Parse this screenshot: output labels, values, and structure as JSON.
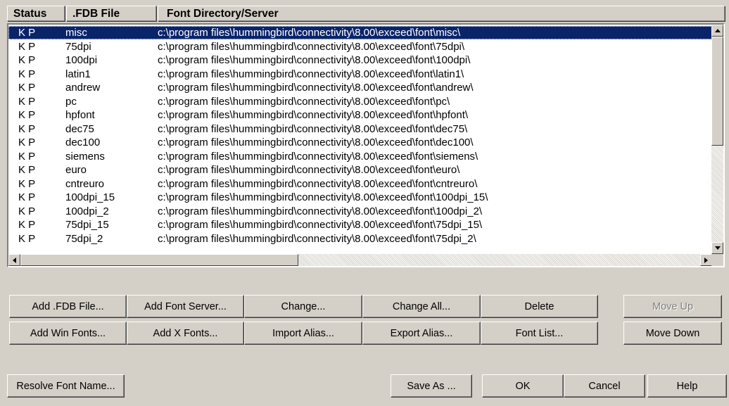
{
  "columns": {
    "status": "Status",
    "fdb": ".FDB File",
    "dir": "Font Directory/Server"
  },
  "rows": [
    {
      "status": "K P",
      "file": "misc",
      "dir": "c:\\program files\\hummingbird\\connectivity\\8.00\\exceed\\font\\misc\\"
    },
    {
      "status": "K P",
      "file": "75dpi",
      "dir": "c:\\program files\\hummingbird\\connectivity\\8.00\\exceed\\font\\75dpi\\"
    },
    {
      "status": "K P",
      "file": "100dpi",
      "dir": "c:\\program files\\hummingbird\\connectivity\\8.00\\exceed\\font\\100dpi\\"
    },
    {
      "status": "K P",
      "file": "latin1",
      "dir": "c:\\program files\\hummingbird\\connectivity\\8.00\\exceed\\font\\latin1\\"
    },
    {
      "status": "K P",
      "file": "andrew",
      "dir": "c:\\program files\\hummingbird\\connectivity\\8.00\\exceed\\font\\andrew\\"
    },
    {
      "status": "K P",
      "file": "pc",
      "dir": "c:\\program files\\hummingbird\\connectivity\\8.00\\exceed\\font\\pc\\"
    },
    {
      "status": "K P",
      "file": "hpfont",
      "dir": "c:\\program files\\hummingbird\\connectivity\\8.00\\exceed\\font\\hpfont\\"
    },
    {
      "status": "K P",
      "file": "dec75",
      "dir": "c:\\program files\\hummingbird\\connectivity\\8.00\\exceed\\font\\dec75\\"
    },
    {
      "status": "K P",
      "file": "dec100",
      "dir": "c:\\program files\\hummingbird\\connectivity\\8.00\\exceed\\font\\dec100\\"
    },
    {
      "status": "K P",
      "file": "siemens",
      "dir": "c:\\program files\\hummingbird\\connectivity\\8.00\\exceed\\font\\siemens\\"
    },
    {
      "status": "K P",
      "file": "euro",
      "dir": "c:\\program files\\hummingbird\\connectivity\\8.00\\exceed\\font\\euro\\"
    },
    {
      "status": "K P",
      "file": "cntreuro",
      "dir": "c:\\program files\\hummingbird\\connectivity\\8.00\\exceed\\font\\cntreuro\\"
    },
    {
      "status": "K P",
      "file": "100dpi_15",
      "dir": "c:\\program files\\hummingbird\\connectivity\\8.00\\exceed\\font\\100dpi_15\\"
    },
    {
      "status": "K P",
      "file": "100dpi_2",
      "dir": "c:\\program files\\hummingbird\\connectivity\\8.00\\exceed\\font\\100dpi_2\\"
    },
    {
      "status": "K P",
      "file": "75dpi_15",
      "dir": "c:\\program files\\hummingbird\\connectivity\\8.00\\exceed\\font\\75dpi_15\\"
    },
    {
      "status": "K P",
      "file": "75dpi_2",
      "dir": "c:\\program files\\hummingbird\\connectivity\\8.00\\exceed\\font\\75dpi_2\\"
    }
  ],
  "selected_row": "misc",
  "buttons": {
    "add_fdb": "Add .FDB File...",
    "add_server": "Add Font Server...",
    "change": "Change...",
    "change_all": "Change All...",
    "delete": "Delete",
    "move_up": "Move Up",
    "add_win": "Add Win Fonts...",
    "add_x": "Add X Fonts...",
    "import_alias": "Import Alias...",
    "export_alias": "Export Alias...",
    "font_list": "Font List...",
    "move_down": "Move Down",
    "resolve": "Resolve Font Name...",
    "save_as": "Save As ...",
    "ok": "OK",
    "cancel": "Cancel",
    "help": "Help"
  },
  "disabled_buttons": [
    "move_up"
  ],
  "colors": {
    "selection": "#0a246a",
    "face": "#d4d0c8"
  }
}
